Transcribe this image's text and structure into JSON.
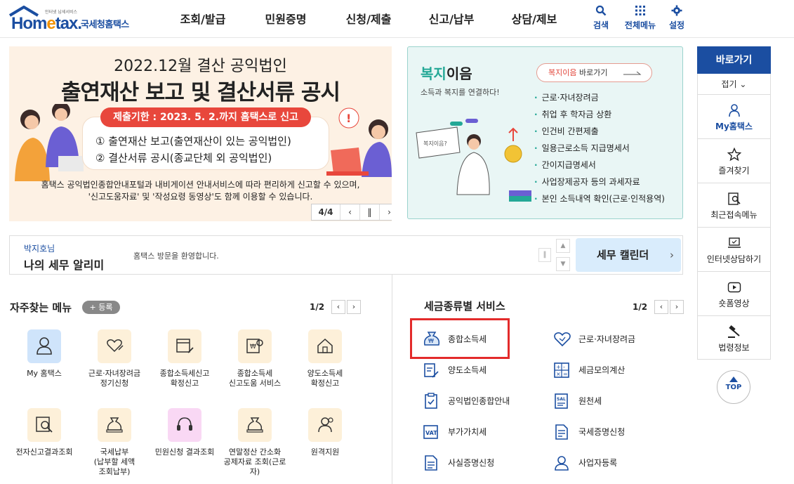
{
  "header": {
    "logo_tiny": "인터넷 납세서비스",
    "logo_brand_a": "Hom",
    "logo_brand_e": "e",
    "logo_brand_b": "tax.",
    "logo_kr": "국세청홈택스",
    "gnb": [
      "조회/발급",
      "민원증명",
      "신청/제출",
      "신고/납부",
      "상담/제보"
    ],
    "util": {
      "search": "검색",
      "all_menu": "전체메뉴",
      "settings": "설정"
    }
  },
  "banner": {
    "line1": "2022.12월 결산 공익법인",
    "line2": "출연재산 보고 및 결산서류 공시",
    "deadline": "제출기한 : 2023. 5. 2.까지 홈택스로 신고",
    "item1": "① 출연재산 보고(출연재산이 있는 공익법인)",
    "item2": "② 결산서류 공시(종교단체 외 공익법인)",
    "desc1": "홈택스 공익법인종합안내포털과 내비게이션 안내서비스에 따라 편리하게 신고할 수 있으며,",
    "desc2": "'신고도움자료' 및 '작성요령 동영상'도 함께 이용할 수 있습니다.",
    "pager": "4/4"
  },
  "welfare": {
    "title_a": "복지",
    "title_b": "이음",
    "sub": "소득과 복지를 연결하다!",
    "shortcut_a": "복지이음",
    "shortcut_b": " 바로가기",
    "bubble": "복지이음?",
    "items": [
      "근로·자녀장려금",
      "취업 후 학자금 상환",
      "인건비 간편제출",
      "일용근로소득 지급명세서",
      "간이지급명세서",
      "사업장제공자 등의 과세자료",
      "본인 소득내역 확인(근로·인적용역)"
    ]
  },
  "notice": {
    "who": "박지호님",
    "title": "나의 세무 알리미",
    "message": "홈택스 방문을 환영합니다.",
    "calendar": "세무 캘린더"
  },
  "sidebar": {
    "header": "바로가기",
    "fold": "접기",
    "items": [
      "My홈택스",
      "즐겨찾기",
      "최근접속메뉴",
      "인터넷상담하기",
      "숏폼영상",
      "법령정보"
    ],
    "top": "TOP"
  },
  "freq": {
    "title": "자주찾는 메뉴",
    "register": "+ 등록",
    "page": "1/2",
    "items": [
      "My 홈택스",
      "근로·자녀장려금\n정기신청",
      "종합소득세신고\n확정신고",
      "종합소득세\n신고도움 서비스",
      "양도소득세\n확정신고",
      "전자신고결과조회",
      "국세납부\n(납부할 세액\n조회납부)",
      "민원신청 결과조회",
      "연말정산 간소화\n공제자료 조회(근로\n자)",
      "원격지원"
    ]
  },
  "tax": {
    "title": "세금종류별 서비스",
    "page": "1/2",
    "left": [
      "종합소득세",
      "양도소득세",
      "공익법인종합안내",
      "부가가치세",
      "사실증명신청"
    ],
    "right": [
      "근로·자녀장려금",
      "세금모의계산",
      "원천세",
      "국세증명신청",
      "사업자등록"
    ]
  }
}
